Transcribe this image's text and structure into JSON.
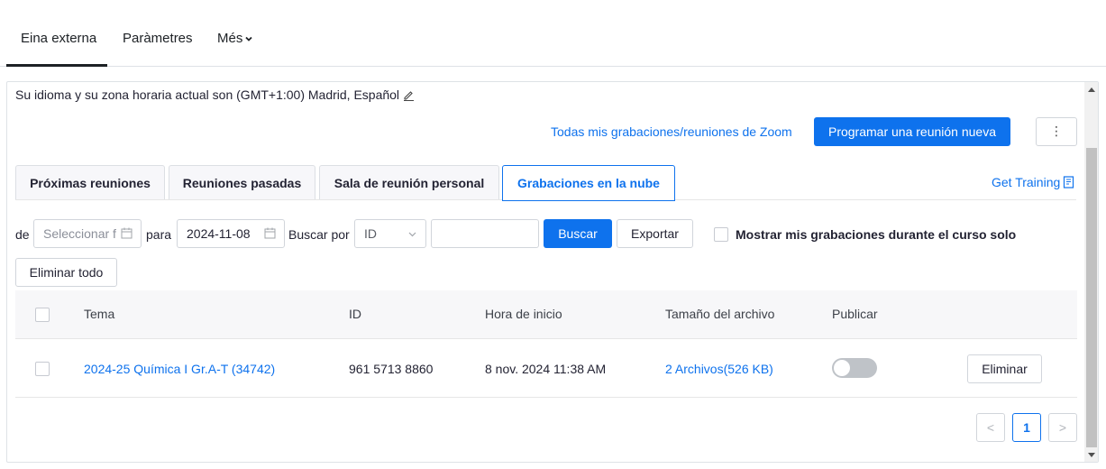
{
  "topnav": {
    "tabs": [
      {
        "label": "Eina externa",
        "active": true
      },
      {
        "label": "Paràmetres"
      },
      {
        "label": "Més"
      }
    ]
  },
  "timezone_text": "Su idioma y su zona horaria actual son (GMT+1:00) Madrid, Español",
  "all_recordings_link": "Todas mis grabaciones/reuniones de Zoom",
  "schedule_button": "Programar una reunión nueva",
  "more_button": "⋮",
  "subtabs": [
    {
      "label": "Próximas reuniones"
    },
    {
      "label": "Reuniones pasadas"
    },
    {
      "label": "Sala de reunión personal"
    },
    {
      "label": "Grabaciones en la nube",
      "active": true
    }
  ],
  "get_training": "Get Training",
  "filters": {
    "from_label": "de",
    "from_placeholder": "Seleccionar f",
    "to_label": "para",
    "to_value": "2024-11-08",
    "search_by_label": "Buscar por",
    "search_by_value": "ID",
    "search_value": "",
    "search_button": "Buscar",
    "export_button": "Exportar",
    "only_course_label": "Mostrar mis grabaciones durante el curso solo",
    "delete_all_button": "Eliminar todo"
  },
  "table": {
    "headers": [
      "Tema",
      "ID",
      "Hora de inicio",
      "Tamaño del archivo",
      "Publicar"
    ],
    "rows": [
      {
        "topic": "2024-25 Química I Gr.A-T (34742)",
        "id": "961 5713 8860",
        "start_time": "8 nov. 2024 11:38 AM",
        "file_size": "2 Archivos(526 KB)",
        "published": false,
        "delete_label": "Eliminar"
      }
    ]
  },
  "pagination": {
    "prev": "<",
    "current": "1",
    "next": ">"
  },
  "colors": {
    "accent": "#0e72ed",
    "text": "#232333",
    "border": "#d1d5db"
  }
}
